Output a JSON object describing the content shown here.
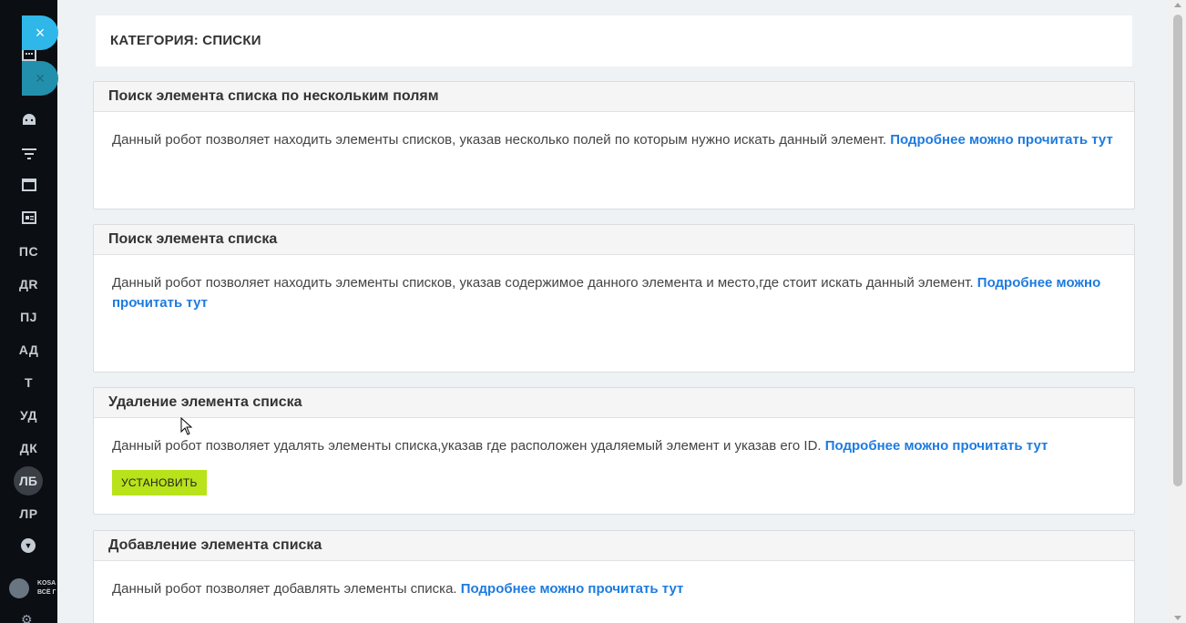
{
  "sidebar": {
    "items": [
      {
        "icon": "menu-icon"
      },
      {
        "icon": "calculator-icon"
      },
      {
        "icon": "clock-icon"
      },
      {
        "icon": "android-icon"
      },
      {
        "icon": "filter-icon"
      },
      {
        "icon": "browser-window-icon"
      },
      {
        "icon": "contact-card-icon"
      },
      {
        "label": "ПС"
      },
      {
        "label": "ДR"
      },
      {
        "label": "ПJ"
      },
      {
        "label": "АД"
      },
      {
        "label": "Т"
      },
      {
        "label": "УД"
      },
      {
        "label": "ДК"
      },
      {
        "label": "ЛБ",
        "active": true
      },
      {
        "label": "ЛР"
      }
    ],
    "logo_text_line1": "KOSA",
    "logo_text_line2": "ВСЁ Г"
  },
  "overlay": {
    "close_icon": "×"
  },
  "category": {
    "title": "КАТЕГОРИЯ: СПИСКИ"
  },
  "cards": [
    {
      "title": "Поиск элемента списка по нескольким полям",
      "description": "Данный робот позволяет находить элементы списков, указав несколько полей по которым нужно искать данный элемент.",
      "link": "Подробнее можно прочитать тут"
    },
    {
      "title": "Поиск элемента списка",
      "description": "Данный робот позволяет находить элементы списков, указав содержимое данного элемента и место,где стоит искать данный элемент.",
      "link": "Подробнее можно прочитать тут"
    },
    {
      "title": "Удаление элемента списка",
      "description": "Данный робот позволяет удалять элементы списка,указав где расположен удаляемый элемент и указав его ID.",
      "link": "Подробнее можно прочитать тут",
      "button": "УСТАНОВИТЬ"
    },
    {
      "title": "Добавление элемента списка",
      "description": "Данный робот позволяет добавлять элементы списка.",
      "link": "Подробнее можно прочитать тут"
    }
  ],
  "colors": {
    "sidebar_bg": "#0b0e12",
    "accent_link": "#1e7be0",
    "install_button": "#b8e21a",
    "close_button": "#2fb7ea"
  }
}
